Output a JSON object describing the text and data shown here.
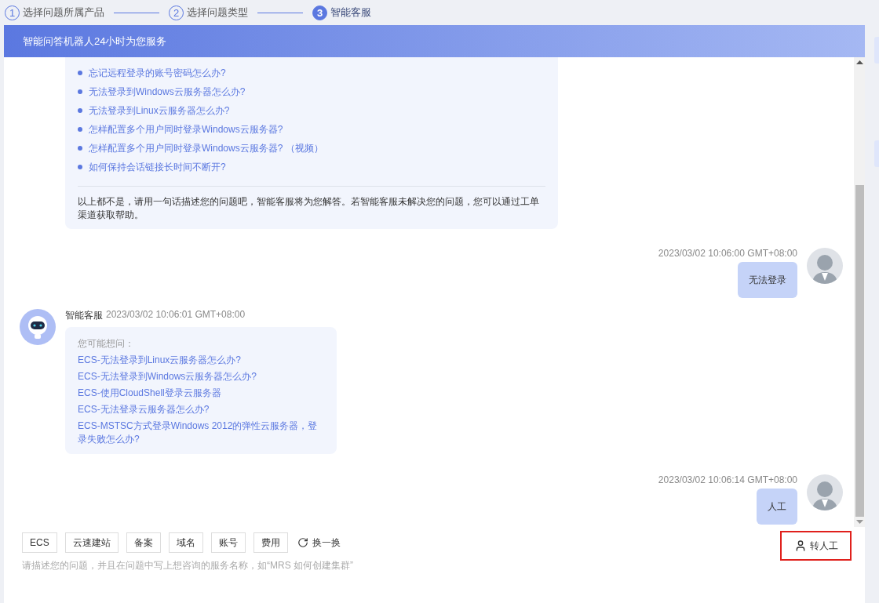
{
  "steps": [
    {
      "number": "1",
      "label": "选择问题所属产品",
      "selected": false
    },
    {
      "number": "2",
      "label": "选择问题类型",
      "selected": false
    },
    {
      "number": "3",
      "label": "智能客服",
      "selected": true
    }
  ],
  "banner": {
    "title": "智能问答机器人24小时为您服务"
  },
  "messages": [
    {
      "kind": "bot_list",
      "links": [
        "忘记远程登录的账号密码怎么办?",
        "无法登录到Windows云服务器怎么办?",
        "无法登录到Linux云服务器怎么办?",
        "怎样配置多个用户同时登录Windows云服务器?",
        "怎样配置多个用户同时登录Windows云服务器? （视频）",
        "如何保持会话链接长时间不断开?"
      ],
      "note": "以上都不是，请用一句话描述您的问题吧，智能客服将为您解答。若智能客服未解决您的问题，您可以通过工单渠道获取帮助。"
    },
    {
      "kind": "user",
      "time": "2023/03/02 10:06:00 GMT+08:00",
      "text": "无法登录"
    },
    {
      "kind": "bot_suggest",
      "sender": "智能客服",
      "time": "2023/03/02 10:06:01 GMT+08:00",
      "heading": "您可能想问：",
      "links": [
        "ECS-无法登录到Linux云服务器怎么办?",
        "ECS-无法登录到Windows云服务器怎么办?",
        "ECS-使用CloudShell登录云服务器",
        "ECS-无法登录云服务器怎么办?",
        "ECS-MSTSC方式登录Windows 2012的弹性云服务器，登录失败怎么办?"
      ]
    },
    {
      "kind": "user",
      "time": "2023/03/02 10:06:14 GMT+08:00",
      "text": "人工"
    }
  ],
  "quick_tags": [
    "ECS",
    "云速建站",
    "备案",
    "域名",
    "账号",
    "费用"
  ],
  "refresh_label": "换一换",
  "transfer_button": {
    "label": "转人工",
    "highlighted": true
  },
  "input": {
    "placeholder": "请描述您的问题，并且在问题中写上想咨询的服务名称，如“MRS 如何创建集群”"
  }
}
